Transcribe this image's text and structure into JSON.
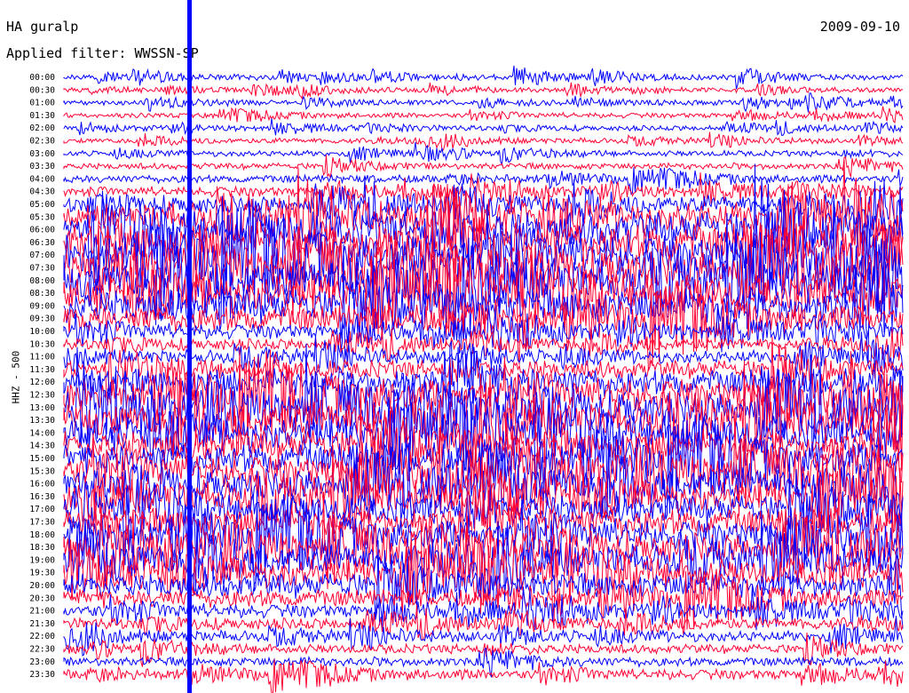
{
  "header": {
    "station": "HA guralp",
    "date": "2009-09-10",
    "filter": "Applied filter: WWSSN-SP"
  },
  "chart_data": {
    "type": "line",
    "ylabel": "HHZ - 500",
    "row_labels": [
      "00:00",
      "00:30",
      "01:00",
      "01:30",
      "02:00",
      "02:30",
      "03:00",
      "03:30",
      "04:00",
      "04:30",
      "05:00",
      "05:30",
      "06:00",
      "06:30",
      "07:00",
      "07:30",
      "08:00",
      "08:30",
      "09:00",
      "09:30",
      "10:00",
      "10:30",
      "11:00",
      "11:30",
      "12:00",
      "12:30",
      "13:00",
      "13:30",
      "14:00",
      "14:30",
      "15:00",
      "15:30",
      "16:00",
      "16:30",
      "17:00",
      "17:30",
      "18:00",
      "18:30",
      "19:00",
      "19:30",
      "20:00",
      "20:30",
      "21:00",
      "21:30",
      "22:00",
      "22:30",
      "23:00",
      "23:30"
    ],
    "series_colors": [
      "#0000ff",
      "#ff0033"
    ],
    "relative_amplitude": [
      0.5,
      0.4,
      0.45,
      0.45,
      0.45,
      0.45,
      0.5,
      0.55,
      0.7,
      0.9,
      1.5,
      2.5,
      3.2,
      3.5,
      3.5,
      3.4,
      3.4,
      3.2,
      3.0,
      2.4,
      1.3,
      1.0,
      1.1,
      1.6,
      2.4,
      2.8,
      3.0,
      3.0,
      2.9,
      2.8,
      2.8,
      2.8,
      2.7,
      2.6,
      2.5,
      2.5,
      2.6,
      2.6,
      2.5,
      2.5,
      2.2,
      1.6,
      1.2,
      1.0,
      0.9,
      0.8,
      0.8,
      0.9
    ]
  }
}
